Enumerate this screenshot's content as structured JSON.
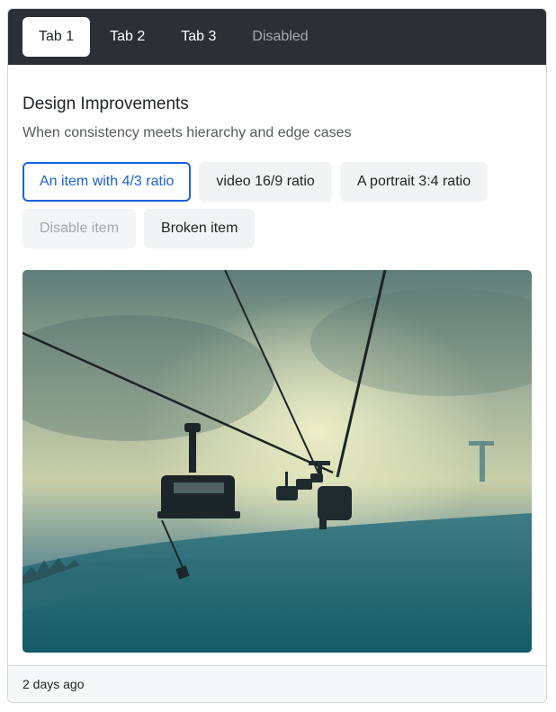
{
  "tabs": [
    {
      "label": "Tab 1",
      "state": "active"
    },
    {
      "label": "Tab 2",
      "state": "normal"
    },
    {
      "label": "Tab 3",
      "state": "normal"
    },
    {
      "label": "Disabled",
      "state": "disabled"
    }
  ],
  "card": {
    "title": "Design Improvements",
    "subtitle": "When consistency meets hierarchy and edge cases",
    "timestamp": "2 days ago"
  },
  "pills": [
    {
      "label": "An item with 4/3 ratio",
      "state": "active"
    },
    {
      "label": "video 16/9 ratio",
      "state": "normal"
    },
    {
      "label": "A portrait 3:4 ratio",
      "state": "normal"
    },
    {
      "label": "Disable item",
      "state": "disabled"
    },
    {
      "label": "Broken item",
      "state": "normal"
    }
  ],
  "image": {
    "subject": "ski chairlift in fog over snowy slope"
  },
  "colors": {
    "tabbar": "#2b3035",
    "accent": "#1a62d8",
    "pill_bg": "#f1f3f5",
    "footer_bg": "#f6f7f8"
  }
}
